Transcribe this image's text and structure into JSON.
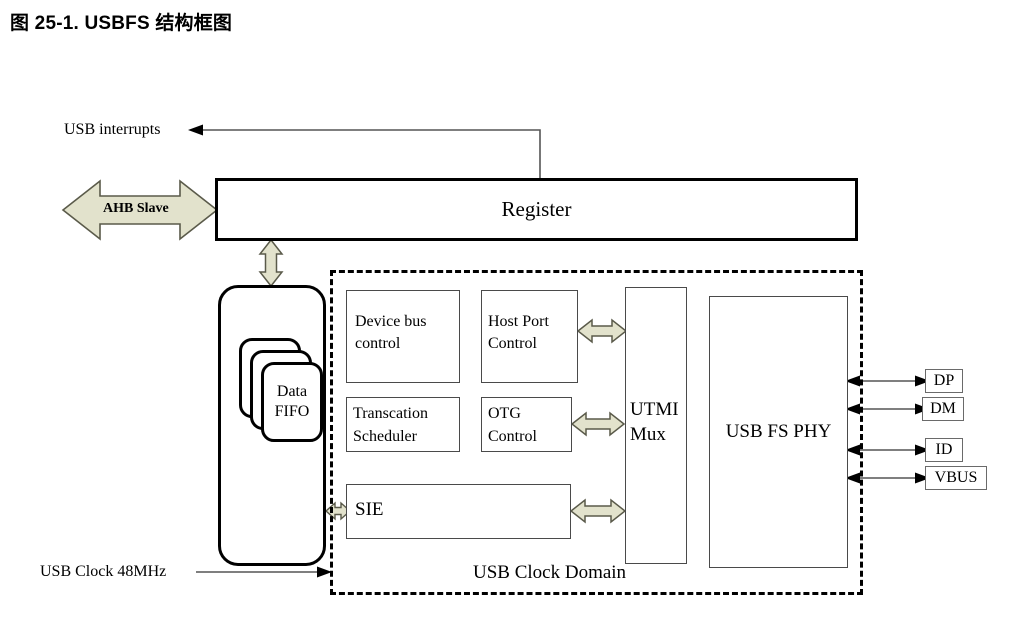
{
  "title": "图 25-1. USBFS 结构框图",
  "diagram": {
    "type": "block-diagram",
    "name": "USBFS block diagram",
    "external_signals": {
      "interrupt_label": "USB interrupts",
      "bus_interface_label": "AHB Slave",
      "clock_label": "USB Clock 48MHz"
    },
    "blocks": [
      {
        "id": "register",
        "label": "Register"
      },
      {
        "id": "data-fifo",
        "label": "Data\nFIFO",
        "line1": "Data",
        "line2": "FIFO"
      },
      {
        "id": "device-bus-control",
        "label": "Device bus\ncontrol",
        "line1": "Device bus",
        "line2": "control"
      },
      {
        "id": "host-port-control",
        "label": "Host Port\nControl",
        "line1": "Host Port",
        "line2": "Control"
      },
      {
        "id": "transcation-scheduler",
        "label": "Transcation\nScheduler",
        "line1": "Transcation",
        "line2": "Scheduler"
      },
      {
        "id": "otg-control",
        "label": "OTG\nControl",
        "line1": "OTG",
        "line2": "Control"
      },
      {
        "id": "sie",
        "label": "SIE"
      },
      {
        "id": "utmi-mux",
        "label": "UTMI\nMux",
        "line1": "UTMI",
        "line2": "Mux"
      },
      {
        "id": "usb-fs-phy",
        "label": "USB FS PHY"
      }
    ],
    "domain_label": "USB Clock Domain",
    "pins": [
      {
        "id": "dp",
        "label": "DP"
      },
      {
        "id": "dm",
        "label": "DM"
      },
      {
        "id": "id",
        "label": "ID"
      },
      {
        "id": "vbus",
        "label": "VBUS"
      }
    ],
    "colors": {
      "arrow_fill": "#e2e2cc",
      "arrow_stroke": "#5a5a4a",
      "line": "#555555",
      "border": "#000000",
      "background": "#ffffff"
    }
  }
}
